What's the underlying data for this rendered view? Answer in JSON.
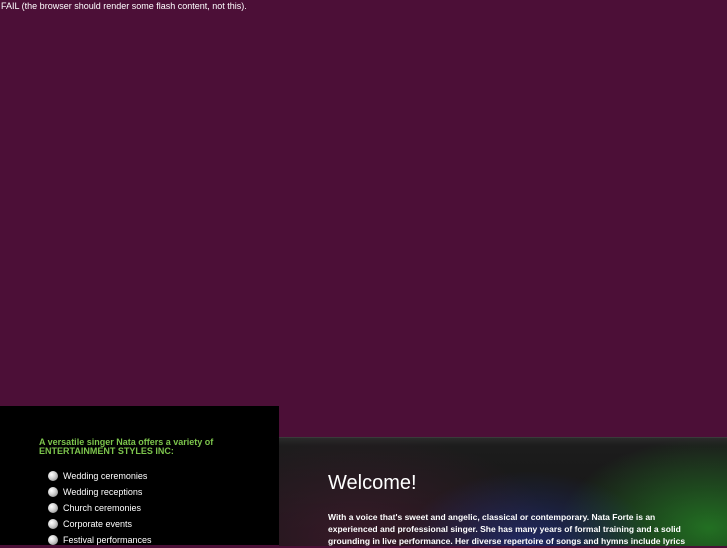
{
  "fail_message": "FAIL (the browser should render some flash content, not this).",
  "left_panel": {
    "intro_line1": "A versatile singer Nata offers a variety of",
    "intro_line2": "ENTERTAINMENT STYLES INC:",
    "services": [
      "Wedding ceremonies",
      "Wedding receptions",
      "Church ceremonies",
      "Corporate events",
      "Festival performances"
    ]
  },
  "main": {
    "heading": "Welcome!",
    "paragraph_lines": [
      "With a voice that's sweet and angelic, classical or contemporary. Nata Forte is an",
      "experienced and professional singer. She has many years of formal training and a solid",
      "grounding in live performance. Her diverse repertoire of songs and hymns include lyrics"
    ]
  },
  "colors": {
    "background": "#4c0f37",
    "left_panel": "#000000",
    "intro_text": "#7cc44c",
    "text": "#ffffff"
  },
  "icons": {
    "service_bullet": "round-bullet-icon"
  }
}
